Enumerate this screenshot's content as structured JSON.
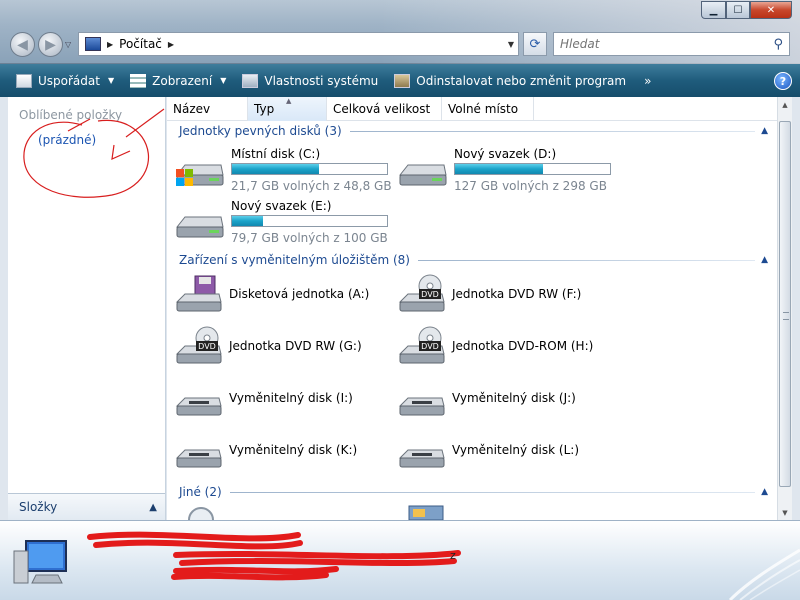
{
  "window": {
    "minimize": "▁",
    "maximize": "☐",
    "close": "✕"
  },
  "address": {
    "current": "Počítač",
    "icon": "computer-icon"
  },
  "search": {
    "placeholder": "Hledat"
  },
  "toolbar": {
    "organize": "Uspořádat",
    "views": "Zobrazení",
    "system_properties": "Vlastnosti systému",
    "uninstall": "Odinstalovat nebo změnit program",
    "more": "»",
    "help": "?"
  },
  "nav": {
    "favorites_header": "Oblíbené položky",
    "favorites_empty": "(prázdné)",
    "folders": "Složky"
  },
  "columns": [
    "Název",
    "Typ",
    "Celková velikost",
    "Volné místo"
  ],
  "groups": {
    "hdd": "Jednotky pevných disků (3)",
    "removable": "Zařízení s vyměnitelným úložištěm (8)",
    "other": "Jiné (2)"
  },
  "drives": [
    {
      "name": "Místní disk (C:)",
      "free_text": "21,7 GB volných z 48,8 GB",
      "used_fraction": 0.56
    },
    {
      "name": "Nový svazek (D:)",
      "free_text": "127 GB volných z 298 GB",
      "used_fraction": 0.57
    },
    {
      "name": "Nový svazek (E:)",
      "free_text": "79,7 GB volných z 100 GB",
      "used_fraction": 0.2
    }
  ],
  "removable": [
    {
      "name": "Disketová jednotka (A:)",
      "icon": "floppy-drive-icon"
    },
    {
      "name": "Jednotka DVD RW (F:)",
      "icon": "dvd-drive-icon"
    },
    {
      "name": "Jednotka DVD RW (G:)",
      "icon": "dvd-drive-icon"
    },
    {
      "name": "Jednotka DVD-ROM (H:)",
      "icon": "dvd-drive-icon"
    },
    {
      "name": "Vyměnitelný disk (I:)",
      "icon": "removable-disk-icon"
    },
    {
      "name": "Vyměnitelný disk (J:)",
      "icon": "removable-disk-icon"
    },
    {
      "name": "Vyměnitelný disk (K:)",
      "icon": "removable-disk-icon"
    },
    {
      "name": "Vyměnitelný disk (L:)",
      "icon": "removable-disk-icon"
    }
  ],
  "colors": {
    "toolbar": "#1f5c7c",
    "group_text": "#1d4a91",
    "bar_fill": "#1ba3c9",
    "annotation": "#d81e1e"
  }
}
